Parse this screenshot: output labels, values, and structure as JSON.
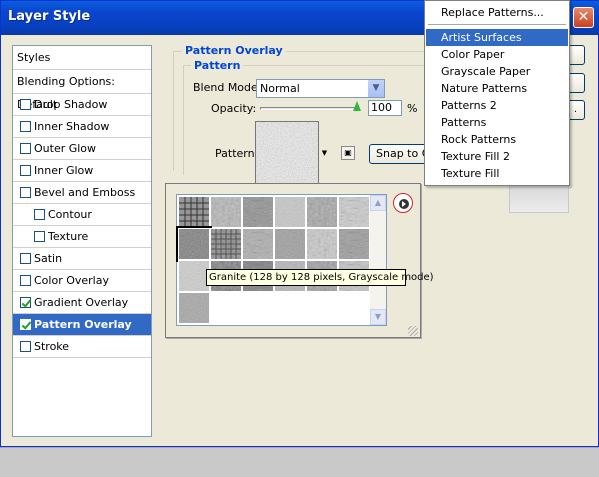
{
  "window": {
    "title": "Layer Style",
    "close_glyph": "✕"
  },
  "styles_panel": {
    "header": "Styles",
    "blending": "Blending Options: Default",
    "items": [
      {
        "label": "Drop Shadow",
        "checked": false
      },
      {
        "label": "Inner Shadow",
        "checked": false
      },
      {
        "label": "Outer Glow",
        "checked": false
      },
      {
        "label": "Inner Glow",
        "checked": false
      },
      {
        "label": "Bevel and Emboss",
        "checked": false
      },
      {
        "label": "Contour",
        "checked": false,
        "sub": true
      },
      {
        "label": "Texture",
        "checked": false,
        "sub": true
      },
      {
        "label": "Satin",
        "checked": false
      },
      {
        "label": "Color Overlay",
        "checked": false
      },
      {
        "label": "Gradient Overlay",
        "checked": true
      },
      {
        "label": "Pattern Overlay",
        "checked": true,
        "selected": true
      },
      {
        "label": "Stroke",
        "checked": false
      }
    ]
  },
  "pattern_overlay": {
    "group_title": "Pattern Overlay",
    "subgroup_title": "Pattern",
    "blend_mode_label": "Blend Mode:",
    "blend_mode_value": "Normal",
    "opacity_label": "Opacity:",
    "opacity_value": "100",
    "opacity_unit": "%",
    "opacity_level": 1.0,
    "pattern_label": "Pattern:",
    "snap_button": "Snap to Origin"
  },
  "picker": {
    "tooltip": "Granite (128 by 128 pixels, Grayscale mode)",
    "selected_index": 6,
    "tile_count": 19
  },
  "menu": {
    "items": [
      "Replace Patterns...",
      "Artist Surfaces",
      "Color Paper",
      "Grayscale Paper",
      "Nature Patterns",
      "Patterns 2",
      "Patterns",
      "Rock Patterns",
      "Texture Fill 2",
      "Texture Fill"
    ],
    "highlighted": "Artist Surfaces"
  },
  "colors": {
    "accent": "#316ac5",
    "title_bar": "#0b46cf",
    "group_label": "#0046d5"
  }
}
